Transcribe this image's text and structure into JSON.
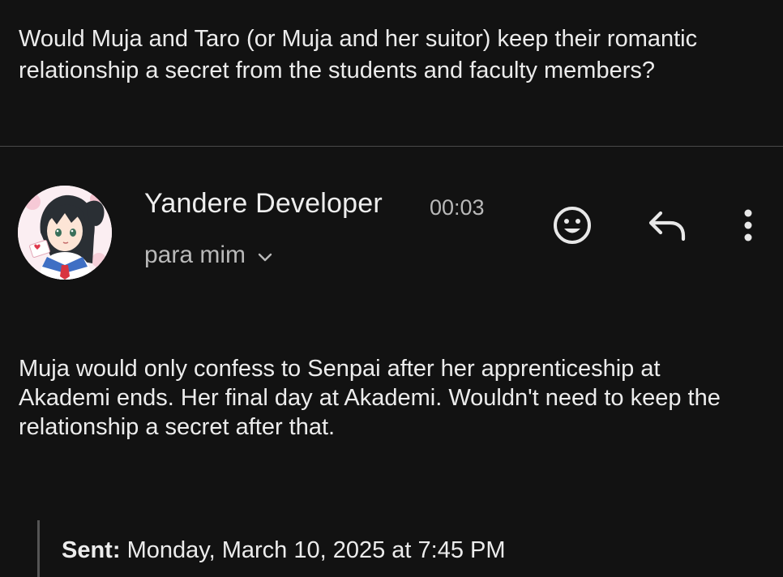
{
  "previous_message": {
    "text": "Would Muja and Taro (or Muja and her suitor) keep their romantic relationship a secret from the students and faculty members?"
  },
  "email": {
    "sender_name": "Yandere Developer",
    "time": "00:03",
    "recipient": "para mim",
    "body": "Muja would only confess to Senpai after her apprenticeship at Akademi ends. Her final day at Akademi. Wouldn't need to keep the relationship a secret after that."
  },
  "quoted": {
    "sent_label": "Sent:",
    "sent_value": "Monday, March 10, 2025 at 7:45 PM"
  },
  "icons": {
    "avatar": "anime-girl-avatar",
    "emoji": "emoji-reaction-icon",
    "reply": "reply-icon",
    "more": "more-vert-icon",
    "expand": "chevron-down-icon"
  },
  "colors": {
    "background": "#121212",
    "text": "#ececec",
    "secondary_text": "#b9b9b9",
    "divider": "#4a4a4a"
  }
}
